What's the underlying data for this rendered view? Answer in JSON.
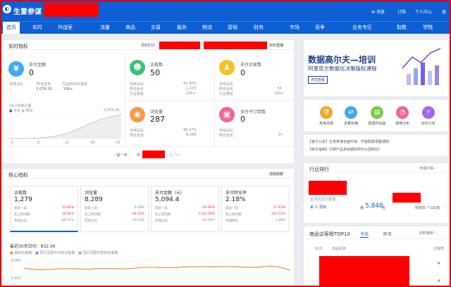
{
  "header": {
    "brand": "生意参谋",
    "messages": "消息",
    "subscribe": "订购",
    "personal_center": "个人中心",
    "exit": "退"
  },
  "nav": [
    "首页",
    "实时",
    "作战室",
    "流量",
    "商品",
    "交易",
    "服务",
    "物流",
    "营销",
    "财务",
    "市场",
    "竞争",
    "业务专区",
    "取数",
    "学院"
  ],
  "realtime": {
    "title": "实时指标",
    "update_time_label": "更新时间",
    "live_link": "实时直播",
    "metrics": [
      {
        "label": "支付金额",
        "value": "0",
        "rows": [
          [
            "无线占比",
            "-",
            "昨日全天",
            "5,074.20",
            "行业前10%排名",
            "100+"
          ]
        ]
      },
      {
        "label": "访客数",
        "value": "50",
        "rows": [
          [
            "无线占比",
            "92.00%"
          ],
          [
            "昨日全天",
            "1,373"
          ],
          [
            "行业排名",
            "100+"
          ]
        ]
      },
      {
        "label": "支付买家数",
        "value": "0",
        "rows": [
          [
            "无线占比",
            "-"
          ],
          [
            "昨日全天",
            "34"
          ],
          [
            "行业排名",
            "100+"
          ]
        ]
      },
      {
        "label": "浏览量",
        "value": "287",
        "rows": [
          [
            "无线占比",
            "96.17%"
          ],
          [
            "昨日全天",
            "8,289"
          ]
        ]
      },
      {
        "label": "支付子订单数",
        "value": "0",
        "rows": [
          [
            "无线占比",
            "-"
          ],
          [
            "昨日全天",
            "57"
          ]
        ]
      }
    ],
    "trend_label": "24小时累计图",
    "legend_today": "今日",
    "legend_yesterday": "昨日",
    "trend_max": "5,074.20",
    "trend_x": [
      "0",
      "6",
      "12",
      "18",
      "23"
    ],
    "prev_day": "前一天",
    "next_day": "后一天"
  },
  "ad": {
    "title": "数据高尔夫—培训",
    "subtitle": "阿里官方数据化决策版权课程",
    "cta": "点击查看"
  },
  "tools": [
    {
      "label": "竞争情报",
      "color": "#f5a623",
      "icon": "🛡"
    },
    {
      "label": "流量纵横",
      "color": "#3fa9f5",
      "icon": "⇄"
    },
    {
      "label": "数据作战室",
      "color": "#7ac943",
      "icon": "▤"
    },
    {
      "label": "德律分析",
      "color": "#f0649b",
      "icon": "◔"
    },
    {
      "label": "财务分析",
      "color": "#9b6cf0",
      "icon": "⚡"
    }
  ],
  "notices": [
    "【官方公告】生意参谋全面升级：开放取数调整通知",
    "【新手指南】付费产品未到期的你可以回收吗？"
  ],
  "core": {
    "title": "核心指标",
    "more": "自助取数",
    "boxes": [
      {
        "title": "访客数",
        "value": "1,279",
        "rows": [
          [
            "较前一日",
            "13.64%",
            "up"
          ],
          [
            "较上周同期",
            "36.64%",
            "up"
          ],
          [
            "无线占比",
            "86.47%",
            ""
          ]
        ]
      },
      {
        "title": "浏览量",
        "value": "8,289",
        "rows": [
          [
            "较前一日",
            "9.39%",
            "dn"
          ],
          [
            "较上周同期",
            "46.32%",
            "up"
          ],
          [
            "无线占比",
            "93.03%",
            ""
          ]
        ]
      },
      {
        "title": "支付金额（元）",
        "value": "5,094.4",
        "rows": [
          [
            "较前一日",
            "62.66%",
            "up"
          ],
          [
            "较上周同期",
            "1142.09%",
            "up"
          ],
          [
            "无线占比",
            "83.06%",
            ""
          ]
        ]
      },
      {
        "title": "支付转化率",
        "value": "2.18%",
        "rows": [
          [
            "较前一日",
            "27.43%",
            "up"
          ],
          [
            "较上周同期",
            "241.51%",
            "up"
          ],
          [
            "无线转化",
            "1.86%",
            ""
          ]
        ]
      }
    ],
    "avg_label": "最近30天日均：832.56",
    "legend": [
      "我的访客数",
      "同行同层平均的访客数",
      "同行同层优秀的访客数"
    ],
    "y_labels": [
      "3,000",
      "2,250"
    ]
  },
  "industry": {
    "title": "行业排行",
    "link": "市场行情",
    "last_days": "近30天支付金额",
    "rank": "第 三 层级",
    "count_label": "第",
    "count_value": "5,848",
    "count_suffix": "名",
    "change_label": "较前日",
    "change_value": "132名"
  },
  "top10": {
    "title": "商品访客榜TOP10",
    "tabs": [
      "今天",
      "昨天"
    ],
    "link": "实时榜单",
    "col_rank": "名次",
    "col_name": "商品名称",
    "col_value": "访客数",
    "values": [
      "4",
      "4"
    ]
  },
  "colors": {
    "primary": "#0d5fd3",
    "icon_blue": "#3fa9f5",
    "icon_green": "#3cc07a",
    "icon_yellow": "#f5a623",
    "icon_orange": "#f59a4a",
    "icon_pink": "#f0649b",
    "redaction": "#ff0000"
  }
}
